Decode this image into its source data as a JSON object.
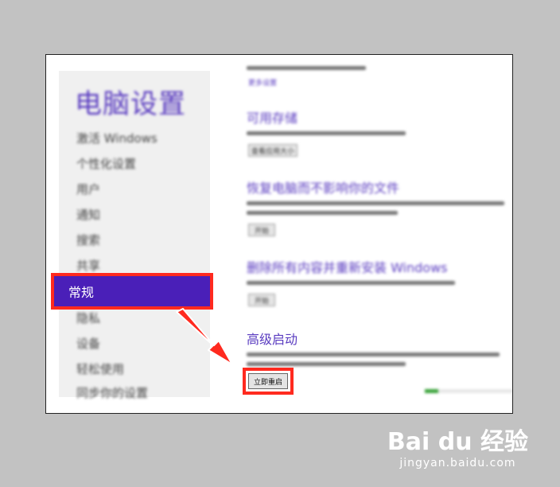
{
  "sidebar": {
    "title": "电脑设置",
    "items": [
      "激活 Windows",
      "个性化设置",
      "用户",
      "通知",
      "搜索",
      "共享",
      "常规",
      "隐私",
      "设备",
      "轻松使用",
      "同步你的设置"
    ],
    "active_item": "常规"
  },
  "main": {
    "top_link": "更多设置",
    "sections": [
      {
        "heading": "可用存储",
        "button": "查看应用大小"
      },
      {
        "heading": "恢复电脑而不影响你的文件",
        "button": "开始"
      },
      {
        "heading": "删除所有内容并重新安装 Windows",
        "button": "开始"
      }
    ],
    "advanced": {
      "heading": "高级启动",
      "button": "立即重启"
    }
  },
  "progress": {
    "value": 0.15,
    "color": "#3aa33a"
  },
  "colors": {
    "accent": "#4a1fb8",
    "highlight": "#ff2a1f"
  },
  "watermark": {
    "logo": "Bai du 经验",
    "sub": "jingyan.baidu.com"
  }
}
